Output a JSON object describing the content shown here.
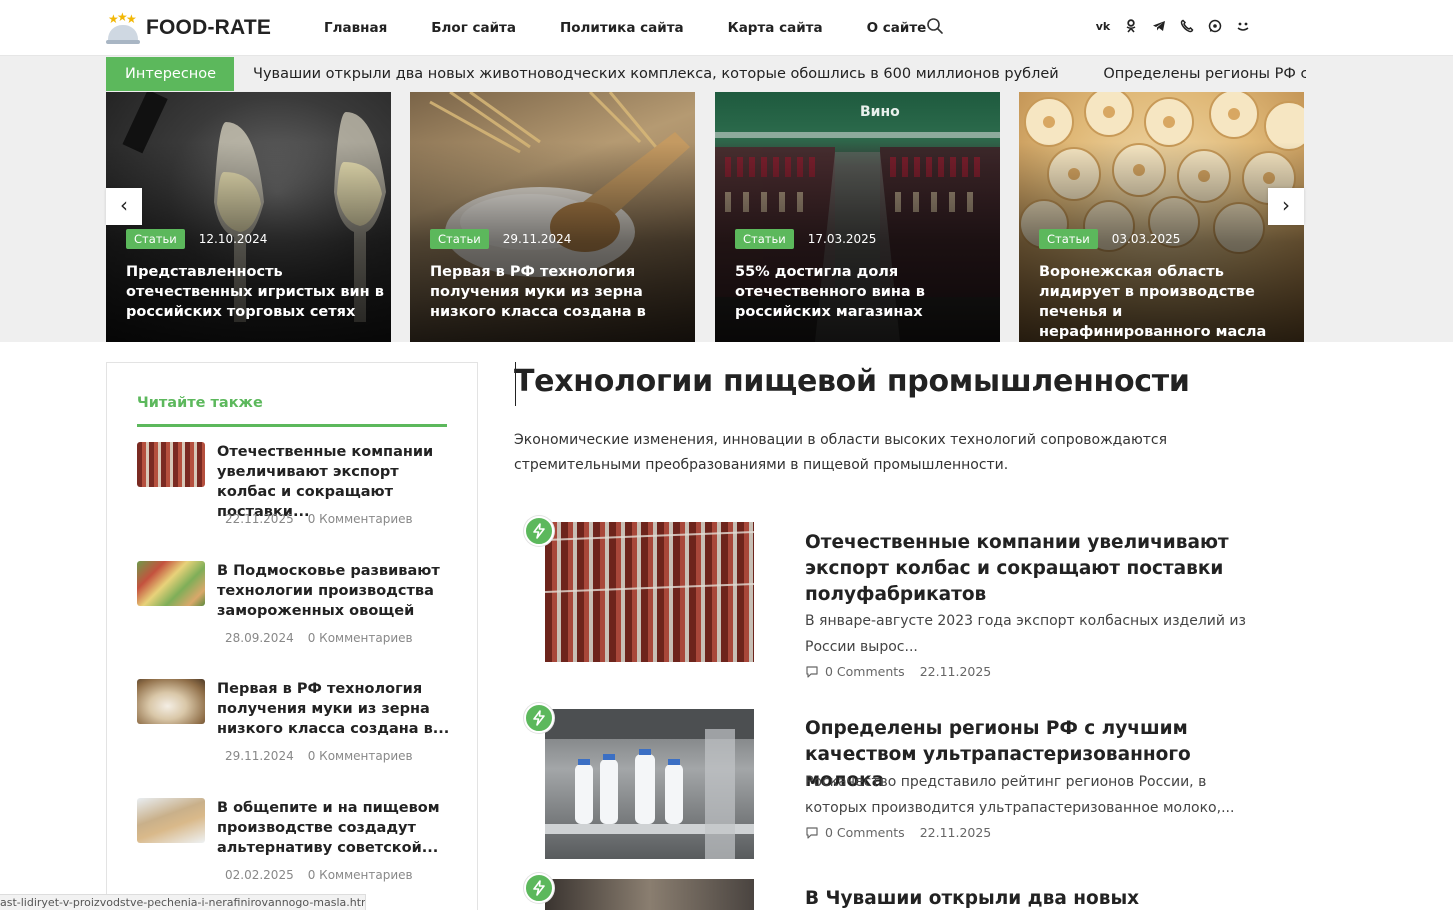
{
  "brand": {
    "name": "FOOD-RATE",
    "accent": "#5cb85c"
  },
  "nav": {
    "items": [
      "Главная",
      "Блог сайта",
      "Политика сайта",
      "Карта сайта",
      "О сайте"
    ]
  },
  "social": [
    "vk-icon",
    "odnoklassniki-icon",
    "telegram-icon",
    "viber-icon",
    "whatsapp-icon",
    "dzen-icon"
  ],
  "ticker": {
    "label": "Интересное",
    "items": [
      "Чувашии открыли два новых животноводческих комплекса, которые обошлись в 600 миллионов рублей",
      "Определены регионы РФ с лучшим качеством ультрапастеризованного молока"
    ]
  },
  "slider": {
    "slides": [
      {
        "badge": "Статьи",
        "date": "12.10.2024",
        "title": "Представленность отечественных игристых вин в российских торговых сетях"
      },
      {
        "badge": "Статьи",
        "date": "29.11.2024",
        "title": "Первая в РФ технология получения муки из зерна низкого класса создана в"
      },
      {
        "badge": "Статьи",
        "date": "17.03.2025",
        "title": "55% достигла доля отечественного вина в российских магазинах"
      },
      {
        "badge": "Статьи",
        "date": "03.03.2025",
        "title": "Воронежская область лидирует в производстве печенья и нерафинированного масла"
      }
    ],
    "prev": "‹",
    "next": "›"
  },
  "sidebar": {
    "title": "Читайте также",
    "items": [
      {
        "title": "Отечественные компании увеличивают экспорт колбас и сокращают поставки...",
        "date": "22.11.2025",
        "comments": "0 Комментариев"
      },
      {
        "title": "В Подмосковье развивают технологии производства замороженных овощей",
        "date": "28.09.2024",
        "comments": "0 Комментариев"
      },
      {
        "title": "Первая в РФ технология получения муки из зерна низкого класса создана в...",
        "date": "29.11.2024",
        "comments": "0 Комментариев"
      },
      {
        "title": "В общепите и на пищевом производстве создадут альтернативу советской...",
        "date": "02.02.2025",
        "comments": "0 Комментариев"
      }
    ]
  },
  "main": {
    "title": "Технологии пищевой промышленности",
    "description": "Экономические изменения, инновации в области высоких технологий сопровождаются стремительными преобразованиями в пищевой промышленности.",
    "posts": [
      {
        "title": "Отечественные компании увеличивают экспорт колбас и сокращают поставки полуфабрикатов",
        "excerpt": "В январе-августе 2023 года экспорт колбасных изделий из России вырос...",
        "comments": "0 Comments",
        "date": "22.11.2025"
      },
      {
        "title": "Определены регионы РФ с лучшим качеством ультрапастеризованного молока",
        "excerpt": "Роскачество представило рейтинг регионов России, в которых производится ультрапастеризованное молоко,...",
        "comments": "0 Comments",
        "date": "22.11.2025"
      },
      {
        "title": "В Чувашии открыли два новых"
      }
    ]
  },
  "status_url": "ast-lidiryet-v-proizvodstve-pechenia-i-nerafinirovannogo-masla.html"
}
